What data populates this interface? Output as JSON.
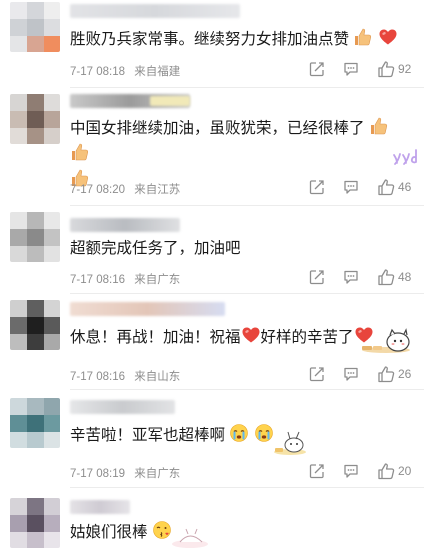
{
  "comments": [
    {
      "text": "胜败乃兵家常事。继续努力女排加油点赞",
      "time": "7-17 08:18",
      "location": "来自福建",
      "likes": "92",
      "emojis": [
        "thumbs-up-icon",
        "red-heart-icon"
      ]
    },
    {
      "text": "中国女排继续加油，虽败犹荣，已经很棒了",
      "time": "7-17 08:20",
      "location": "来自江苏",
      "likes": "46",
      "emojis": [
        "thumbs-up-icon",
        "thumbs-up-icon",
        "thumbs-up-icon"
      ]
    },
    {
      "text": "超额完成任务了，加油吧",
      "time": "7-17 08:16",
      "location": "来自广东",
      "likes": "48",
      "emojis": []
    },
    {
      "text_a": "休息！再战！加油！祝福",
      "text_b": "好样的辛苦了",
      "time": "7-17 08:16",
      "location": "来自山东",
      "likes": "26",
      "emojis": [
        "red-heart-icon",
        "red-heart-icon"
      ]
    },
    {
      "text": "辛苦啦！亚军也超棒啊",
      "time": "7-17 08:19",
      "location": "来自广东",
      "likes": "20",
      "emojis": [
        "crying-face-icon",
        "crying-face-icon"
      ]
    },
    {
      "text": "姑娘们很棒",
      "emojis": [
        "kissing-face-icon"
      ]
    }
  ],
  "colors": {
    "text": "#1a1a1a",
    "meta": "#8d8d8d",
    "heart": "#e8453c",
    "thumb": "#f3b26a"
  }
}
